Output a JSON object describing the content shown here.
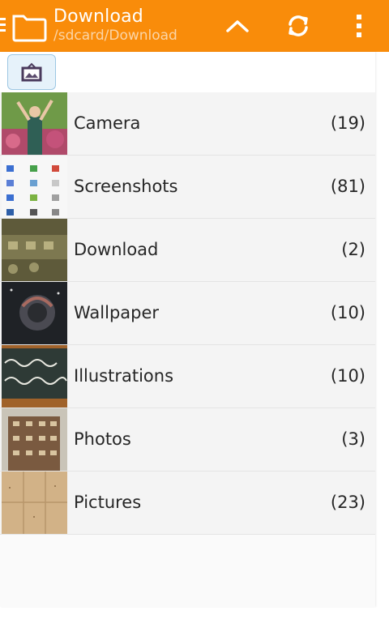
{
  "header": {
    "title": "Download",
    "path": "/sdcard/Download",
    "icons": [
      "menu-icon",
      "folder-icon",
      "chevron-up-icon",
      "sync-icon",
      "overflow-menu-icon"
    ],
    "color": "#f98c0a"
  },
  "toolbar": {
    "view_toggle_icon": "picture-frame-icon"
  },
  "albums": [
    {
      "label": "Camera",
      "count": "(19)"
    },
    {
      "label": "Screenshots",
      "count": "(81)"
    },
    {
      "label": "Download",
      "count": "(2)"
    },
    {
      "label": "Wallpaper",
      "count": "(10)"
    },
    {
      "label": "Illustrations",
      "count": "(10)"
    },
    {
      "label": "Photos",
      "count": "(3)"
    },
    {
      "label": "Pictures",
      "count": "(23)"
    }
  ]
}
